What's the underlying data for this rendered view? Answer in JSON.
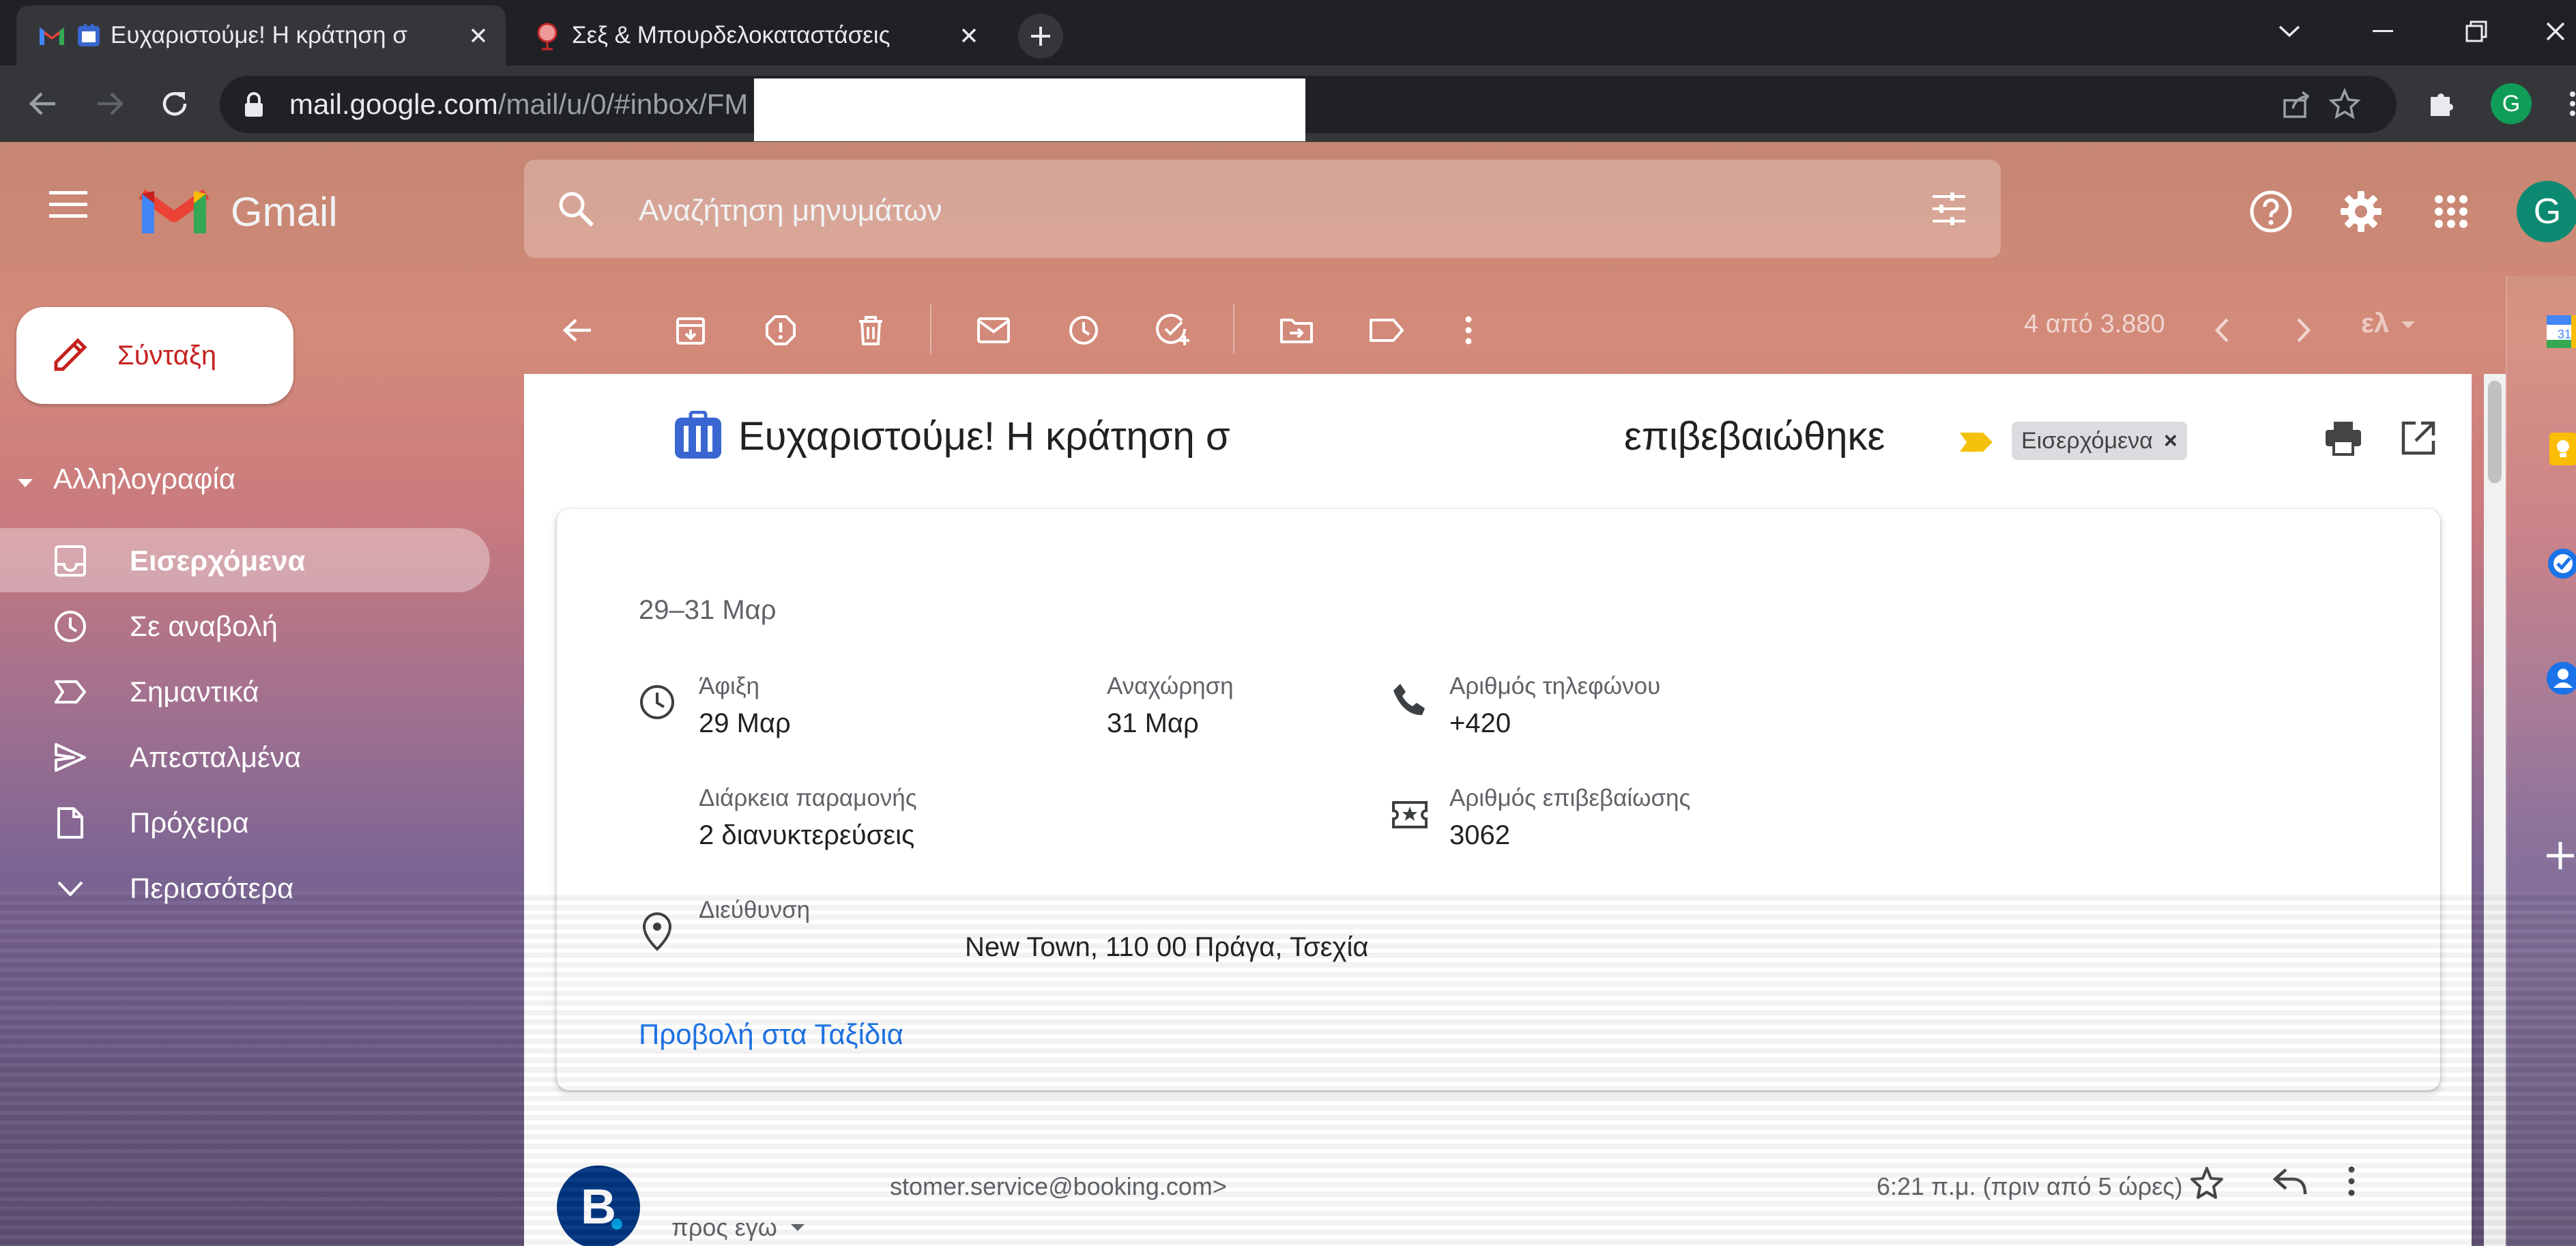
{
  "browser": {
    "tabs": [
      {
        "title": "Ευχαριστούμε! Η κράτηση σ",
        "active": true
      },
      {
        "title": "Σεξ & Μπουρδελοκαταστάσεις",
        "active": false
      }
    ],
    "url_host": "mail.google.com",
    "url_path": "/mail/u/0/#inbox/FM",
    "profile_initial": "G"
  },
  "gmail": {
    "product_name": "Gmail",
    "search_placeholder": "Αναζήτηση μηνυμάτων",
    "account_initial": "G",
    "compose_label": "Σύνταξη",
    "section_label": "Αλληλογραφία",
    "nav": [
      {
        "label": "Εισερχόμενα",
        "icon": "inbox-icon",
        "active": true
      },
      {
        "label": "Σε αναβολή",
        "icon": "snooze-icon",
        "active": false
      },
      {
        "label": "Σημαντικά",
        "icon": "important-icon",
        "active": false
      },
      {
        "label": "Απεσταλμένα",
        "icon": "sent-icon",
        "active": false
      },
      {
        "label": "Πρόχειρα",
        "icon": "draft-icon",
        "active": false
      },
      {
        "label": "Περισσότερα",
        "icon": "expand-more-icon",
        "active": false
      }
    ],
    "pager": "4 από 3.880",
    "language": "ελ"
  },
  "message": {
    "subject_start": "Ευχαριστούμε! Η κράτηση σ",
    "subject_end": "επιβεβαιώθηκε",
    "label": "Εισερχόμενα",
    "card": {
      "dates": "29–31 Μαρ",
      "arrival_label": "Άφιξη",
      "arrival_value": "29 Μαρ",
      "departure_label": "Αναχώρηση",
      "departure_value": "31 Μαρ",
      "phone_label": "Αριθμός τηλεφώνου",
      "phone_value": "+420",
      "stay_label": "Διάρκεια παραμονής",
      "stay_value": "2 διανυκτερεύσεις",
      "confirmation_label": "Αριθμός επιβεβαίωσης",
      "confirmation_value": "3062",
      "address_label": "Διεύθυνση",
      "address_value": "New Town, 110 00 Πράγα, Τσεχία",
      "view_link": "Προβολή στα Ταξίδια"
    },
    "avatar_letter": "B",
    "sender": "stomer.service@booking.com>",
    "to": "προς εγω",
    "time": "6:21 π.μ. (πριν από 5 ώρες)"
  },
  "colors": {
    "compose_text": "#c5221f",
    "link": "#1a73e8",
    "booking_blue": "#003580",
    "important_marker": "#f4c20d"
  }
}
